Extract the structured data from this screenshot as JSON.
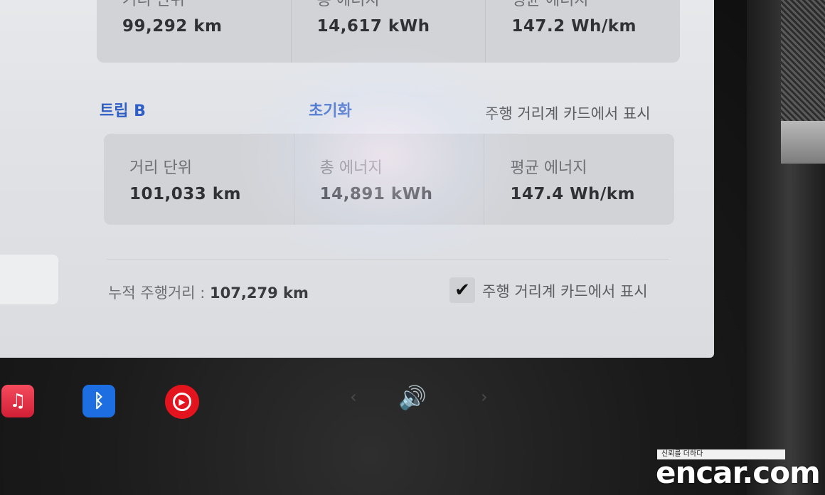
{
  "trip_a": {
    "cells": [
      {
        "label": "거리 단위",
        "value": "99,292 km"
      },
      {
        "label": "총 에너지",
        "value": "14,617 kWh"
      },
      {
        "label": "평균 에너지",
        "value": "147.2 Wh/km"
      }
    ]
  },
  "trip_b": {
    "title": "트립 B",
    "reset_label": "초기화",
    "show_label": "주행 거리계 카드에서 표시",
    "cells": [
      {
        "label": "거리 단위",
        "value": "101,033 km"
      },
      {
        "label": "총 에너지",
        "value": "14,891 kWh"
      },
      {
        "label": "평균 에너지",
        "value": "147.4 Wh/km"
      }
    ]
  },
  "odometer": {
    "label": "누적 주행거리 :",
    "value": "107,279 km"
  },
  "odometer_card_option": {
    "checked": true,
    "label": "주행 거리계 카드에서 표시"
  },
  "dock": {
    "icons": [
      "music-icon",
      "bluetooth-icon",
      "youtube-music-icon"
    ],
    "prev_glyph": "‹",
    "next_glyph": "›",
    "volume_glyph": "🔊"
  },
  "watermark": {
    "tagline": "신뢰를 더하다",
    "logo": "encar.com"
  },
  "colors": {
    "accent_blue": "#2f5fc4",
    "screen_bg": "#e2e4e7",
    "card_bg": "#d2d3d6"
  }
}
